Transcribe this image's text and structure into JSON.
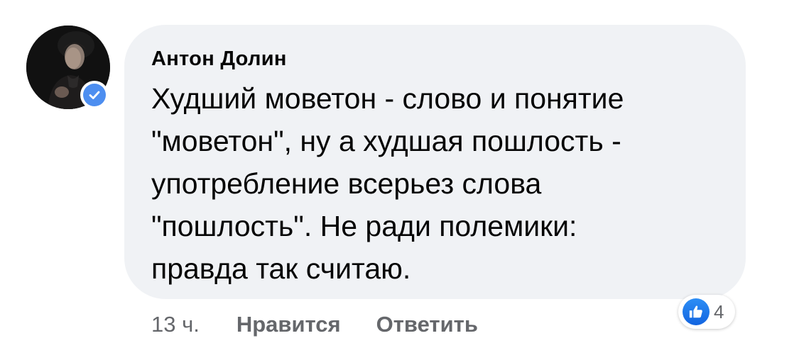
{
  "comment": {
    "author": "Антон Долин",
    "text": "Худший моветон - слово и понятие\n\"моветон\", ну а худшая пошлость -\nупотребление всерьез слова\n\"пошлость\". Не ради полемики:\nправда так считаю.",
    "avatar_icon": "profile-photo",
    "verified_icon": "verified-badge-icon"
  },
  "actions": {
    "time": "13 ч.",
    "like_label": "Нравится",
    "reply_label": "Ответить"
  },
  "reactions": {
    "icon": "like-thumbs-up-icon",
    "count": "4"
  },
  "colors": {
    "bubble": "#f0f2f5",
    "text": "#050505",
    "secondary_text": "#65676b",
    "verified": "#4d8ef0",
    "like": "#1877f2"
  }
}
